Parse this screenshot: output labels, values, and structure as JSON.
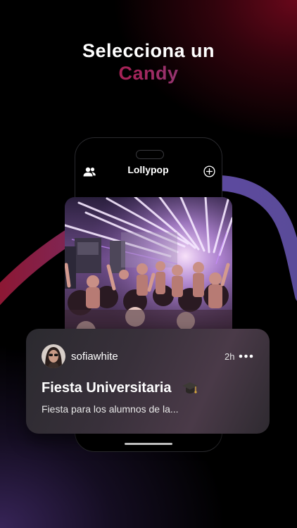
{
  "heading": {
    "line1": "Selecciona un",
    "line2": "Candy"
  },
  "phone": {
    "app_title": "Lollypop",
    "left_icon": "people-icon",
    "right_icon": "add-circle-icon"
  },
  "post": {
    "username": "sofiawhite",
    "time": "2h",
    "more_icon": "more-horizontal-icon",
    "title": "Fiesta Universitaria",
    "title_icon": "graduation-cap-icon",
    "description": "Fiesta para los alumnos de la..."
  },
  "colors": {
    "accent_red": "#b3102e",
    "accent_purple": "#6e62ad",
    "card_bg": "#38303a"
  }
}
